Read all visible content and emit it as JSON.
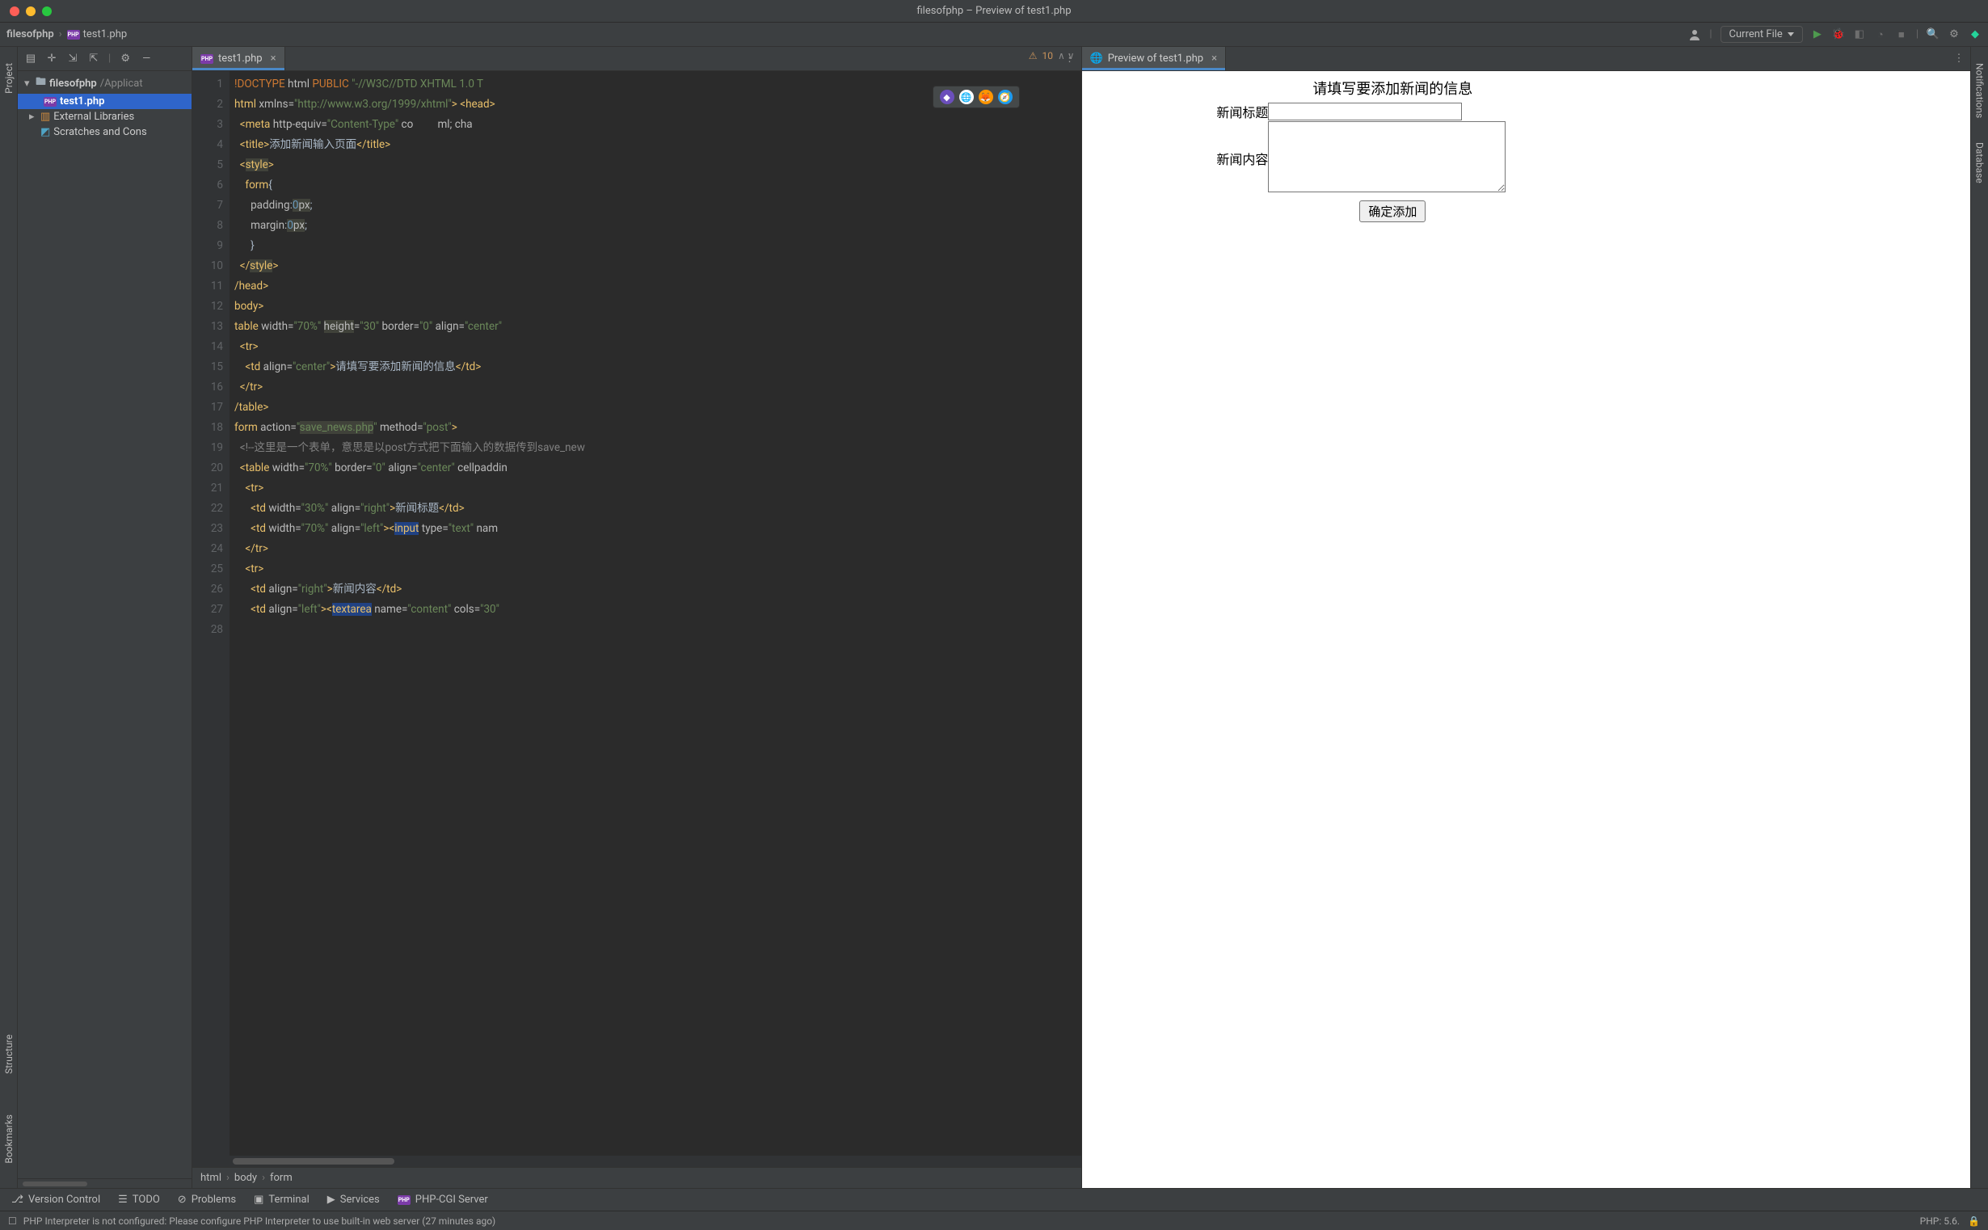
{
  "window": {
    "title": "filesofphp – Preview of test1.php"
  },
  "traffic_colors": {
    "close": "#ff5f57",
    "min": "#febc2e",
    "max": "#28c840"
  },
  "navbar": {
    "project": "filesofphp",
    "file": "test1.php",
    "run_config": "Current File"
  },
  "project_panel": {
    "root": "filesofphp",
    "root_path": "/Applicat",
    "file": "test1.php",
    "external": "External Libraries",
    "scratches": "Scratches and Cons"
  },
  "editor_tab": {
    "label": "test1.php"
  },
  "preview_tab": {
    "label": "Preview of test1.php"
  },
  "editor": {
    "lines": [
      "1",
      "2",
      "3",
      "4",
      "5",
      "6",
      "7",
      "8",
      "9",
      "10",
      "11",
      "12",
      "13",
      "14",
      "15",
      "16",
      "17",
      "18",
      "19",
      "20",
      "21",
      "22",
      "23",
      "24",
      "25",
      "26",
      "27",
      "28"
    ],
    "warn_count": "10",
    "code_rows": [
      {
        "html": "<span class='kw'>!DOCTYPE</span> <span class='attr'>html</span> <span class='kw'>PUBLIC</span> <span class='str'>\"-//W3C//DTD XHTML 1.0 T</span>"
      },
      {
        "html": "<span class='tag'>html</span> <span class='attr'>xmlns=</span><span class='str'>\"http://www.w3.org/1999/xhtml\"</span><span class='tag'>&gt; &lt;head&gt;</span>"
      },
      {
        "html": "  <span class='tag'>&lt;meta</span> <span class='attr'>http-equiv=</span><span class='str'>\"Content-Type\"</span> <span class='attr'>co</span>         <span class='attr'>ml; cha</span>"
      },
      {
        "html": "  <span class='tag'>&lt;title&gt;</span>添加新闻输入页面<span class='tag'>&lt;/title&gt;</span>"
      },
      {
        "html": "  <span class='tag'>&lt;<span class='hl'>style</span>&gt;</span>"
      },
      {
        "html": "    <span class='tag'>form</span>{"
      },
      {
        "html": "      <span class='attr'>padding:</span><span class='num hl'>0</span><span class='attr hl'>px</span>;"
      },
      {
        "html": "      <span class='attr'>margin:</span><span class='num hl'>0</span><span class='attr hl'>px</span>;"
      },
      {
        "html": "      }"
      },
      {
        "html": "  <span class='tag'>&lt;/<span class='hl'>style</span>&gt;</span>"
      },
      {
        "html": "<span class='tag'>/head&gt;</span>"
      },
      {
        "html": "<span class='tag'>body&gt;</span>"
      },
      {
        "html": "<span class='tag'>table</span> <span class='attr'>width=</span><span class='str'>\"70%\"</span> <span class='attr hl'>height</span><span class='attr'>=</span><span class='str'>\"30\"</span> <span class='attr'>border=</span><span class='str'>\"0\"</span> <span class='attr'>align=</span><span class='str'>\"center\"</span>"
      },
      {
        "html": "  <span class='tag'>&lt;tr&gt;</span>"
      },
      {
        "html": "    <span class='tag'>&lt;td</span> <span class='attr'>align=</span><span class='str'>\"center\"</span><span class='tag'>&gt;</span>请填写要添加新闻的信息<span class='tag'>&lt;/td&gt;</span>"
      },
      {
        "html": "  <span class='tag'>&lt;/tr&gt;</span>"
      },
      {
        "html": "<span class='tag'>/table&gt;</span>"
      },
      {
        "html": "<span class='tag'>form</span> <span class='attr'>action=</span><span class='str'>\"<span class='hl'>save_news.php</span>\"</span> <span class='attr'>method=</span><span class='str'>\"post\"</span><span class='tag'>&gt;</span>"
      },
      {
        "html": "  <span class='cmt'>&lt;!--这里是一个表单，意思是以post方式把下面输入的数据传到save_new</span>"
      },
      {
        "html": "  <span class='tag'>&lt;table</span> <span class='attr'>width=</span><span class='str'>\"70%\"</span> <span class='attr'>border=</span><span class='str'>\"0\"</span> <span class='attr'>align=</span><span class='str'>\"center\"</span> <span class='attr'>cellpaddin</span>"
      },
      {
        "html": "    <span class='tag'>&lt;tr&gt;</span>"
      },
      {
        "html": "      <span class='tag'>&lt;td</span> <span class='attr'>width=</span><span class='str'>\"30%\"</span> <span class='attr'>align=</span><span class='str'>\"right\"</span><span class='tag'>&gt;</span>新闻标题<span class='tag'>&lt;/td&gt;</span>"
      },
      {
        "html": "      <span class='tag'>&lt;td</span> <span class='attr'>width=</span><span class='str'>\"70%\"</span> <span class='attr'>align=</span><span class='str'>\"left\"</span><span class='tag'>&gt;&lt;<span class='hl2'>input</span></span> <span class='attr'>type=</span><span class='str'>\"text\"</span> <span class='attr'>nam</span>"
      },
      {
        "html": "    <span class='tag'>&lt;/tr&gt;</span>"
      },
      {
        "html": "    <span class='tag'>&lt;tr&gt;</span>"
      },
      {
        "html": "      <span class='tag'>&lt;td</span> <span class='attr'>align=</span><span class='str'>\"right\"</span><span class='tag'>&gt;</span>新闻内容<span class='tag'>&lt;/td&gt;</span>"
      },
      {
        "html": "      <span class='tag'>&lt;td</span> <span class='attr'>align=</span><span class='str'>\"left\"</span><span class='tag'>&gt;&lt;<span class='hl2'>textarea</span></span> <span class='attr'>name=</span><span class='str'>\"content\"</span> <span class='attr'>cols=</span><span class='str'>\"30\"</span>"
      },
      {
        "html": ""
      }
    ]
  },
  "breadcrumbs": [
    "html",
    "body",
    "form"
  ],
  "preview_form": {
    "heading": "请填写要添加新闻的信息",
    "label_title": "新闻标题",
    "label_content": "新闻内容",
    "submit": "确定添加"
  },
  "toolwindows": {
    "vcs": "Version Control",
    "todo": "TODO",
    "problems": "Problems",
    "terminal": "Terminal",
    "services": "Services",
    "phpcgi": "PHP-CGI Server"
  },
  "left_strip": {
    "project": "Project",
    "structure": "Structure",
    "bookmarks": "Bookmarks"
  },
  "right_strip": {
    "notifications": "Notifications",
    "database": "Database"
  },
  "status": {
    "msg": "PHP Interpreter is not configured: Please configure PHP Interpreter to use built-in web server (27 minutes ago)",
    "php": "PHP: 5.6."
  }
}
